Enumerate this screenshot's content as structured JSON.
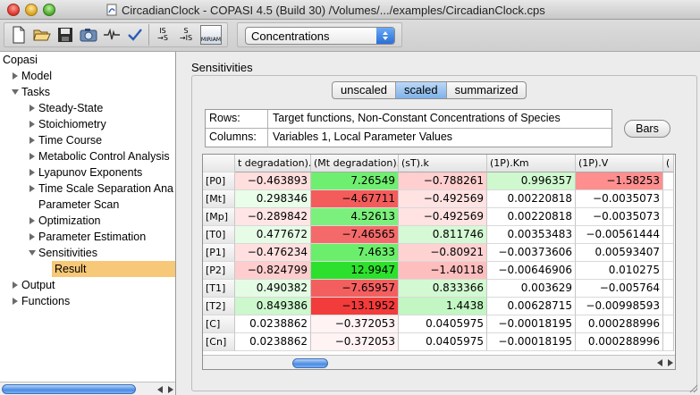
{
  "window": {
    "title": "CircadianClock - COPASI 4.5 (Build 30) /Volumes/.../examples/CircadianClock.cps"
  },
  "toolbar": {
    "buttons": [
      {
        "name": "new-document",
        "icon": "new-document-icon"
      },
      {
        "name": "open",
        "icon": "folder-open-icon"
      },
      {
        "name": "save",
        "icon": "floppy-disk-icon"
      },
      {
        "name": "capture",
        "icon": "camera-icon"
      },
      {
        "name": "signal",
        "icon": "waveform-icon"
      },
      {
        "name": "check",
        "icon": "checkmark-icon"
      },
      {
        "name": "is-to-s",
        "icon": "is-to-s-icon",
        "label_top": "IS",
        "label_bottom": "→S"
      },
      {
        "name": "s-to-is",
        "icon": "s-to-is-icon",
        "label_top": "S",
        "label_bottom": "→IS"
      },
      {
        "name": "miriam",
        "icon": "miriam-icon",
        "label": "MIRIAM"
      }
    ],
    "concentration_select": "Concentrations"
  },
  "tree": {
    "root": "Copasi",
    "items": [
      {
        "label": "Model",
        "expander": "collapsed"
      },
      {
        "label": "Tasks",
        "expander": "expanded"
      },
      {
        "label": "Steady-State",
        "expander": "collapsed"
      },
      {
        "label": "Stoichiometry",
        "expander": "collapsed"
      },
      {
        "label": "Time Course",
        "expander": "collapsed"
      },
      {
        "label": "Metabolic Control Analysis",
        "expander": "collapsed"
      },
      {
        "label": "Lyapunov Exponents",
        "expander": "collapsed"
      },
      {
        "label": "Time Scale Separation Ana",
        "expander": "collapsed"
      },
      {
        "label": "Parameter Scan",
        "expander": "none"
      },
      {
        "label": "Optimization",
        "expander": "collapsed"
      },
      {
        "label": "Parameter Estimation",
        "expander": "collapsed"
      },
      {
        "label": "Sensitivities",
        "expander": "expanded"
      },
      {
        "label": "Result",
        "expander": "none"
      },
      {
        "label": "Output",
        "expander": "collapsed"
      },
      {
        "label": "Functions",
        "expander": "collapsed"
      }
    ]
  },
  "main": {
    "section_title": "Sensitivities",
    "tabs": [
      {
        "label": "unscaled",
        "active": false
      },
      {
        "label": "scaled",
        "active": true
      },
      {
        "label": "summarized",
        "active": false
      }
    ],
    "info": {
      "rows_key": "Rows:",
      "rows_value": "Target functions, Non-Constant Concentrations of Species",
      "columns_key": "Columns:",
      "columns_value": "Variables 1, Local Parameter Values"
    },
    "bars_button": "Bars",
    "grid": {
      "columns": [
        "t degradation).l",
        "(Mt degradation).'",
        "(sT).k",
        "(1P).Km",
        "(1P).V",
        "("
      ],
      "rows": [
        {
          "label": "[P0]",
          "values": [
            "−0.463893",
            "7.26549",
            "−0.788261",
            "0.996357",
            "−1.58253"
          ]
        },
        {
          "label": "[Mt]",
          "values": [
            "0.298346",
            "−4.67711",
            "−0.492569",
            "0.00220818",
            "−0.0035073"
          ]
        },
        {
          "label": "[Mp]",
          "values": [
            "−0.289842",
            "4.52613",
            "−0.492569",
            "0.00220818",
            "−0.0035073"
          ]
        },
        {
          "label": "[T0]",
          "values": [
            "0.477672",
            "−7.46565",
            "0.811746",
            "0.00353483",
            "−0.00561444"
          ]
        },
        {
          "label": "[P1]",
          "values": [
            "−0.476234",
            "7.4633",
            "−0.80921",
            "−0.00373606",
            "0.00593407"
          ]
        },
        {
          "label": "[P2]",
          "values": [
            "−0.824799",
            "12.9947",
            "−1.40118",
            "−0.00646906",
            "0.010275"
          ]
        },
        {
          "label": "[T1]",
          "values": [
            "0.490382",
            "−7.65957",
            "0.833366",
            "0.003629",
            "−0.005764"
          ]
        },
        {
          "label": "[T2]",
          "values": [
            "0.849386",
            "−13.1952",
            "1.4438",
            "0.00628715",
            "−0.00998593"
          ]
        },
        {
          "label": "[C]",
          "values": [
            "0.0238862",
            "−0.372053",
            "0.0405975",
            "−0.00018195",
            "0.000288996"
          ]
        },
        {
          "label": "[Cn]",
          "values": [
            "0.0238862",
            "−0.372053",
            "0.0405975",
            "−0.00018195",
            "0.000288996"
          ]
        }
      ],
      "cell_colors": [
        [
          "#ffdede",
          "#6fef6f",
          "#ffcfcf",
          "#cff8cf",
          "#ff8f8f"
        ],
        [
          "#e9fde9",
          "#f45b5b",
          "#ffe2e2",
          "#ffffff",
          "#ffffff"
        ],
        [
          "#ffe5e5",
          "#7cf07c",
          "#ffe2e2",
          "#ffffff",
          "#ffffff"
        ],
        [
          "#e6fce6",
          "#f46a6a",
          "#d4f9d4",
          "#ffffff",
          "#ffffff"
        ],
        [
          "#ffdfdf",
          "#6bee6b",
          "#ffd2d2",
          "#ffffff",
          "#ffffff"
        ],
        [
          "#ffcdcd",
          "#2de02d",
          "#ffbebe",
          "#ffffff",
          "#ffffff"
        ],
        [
          "#e4fce4",
          "#f35f5f",
          "#d2f9d2",
          "#ffffff",
          "#ffffff"
        ],
        [
          "#cdf7cd",
          "#f23b3b",
          "#c2f6c2",
          "#ffffff",
          "#ffffff"
        ],
        [
          "#ffffff",
          "#fff3f3",
          "#ffffff",
          "#ffffff",
          "#ffffff"
        ],
        [
          "#ffffff",
          "#fff3f3",
          "#ffffff",
          "#ffffff",
          "#ffffff"
        ]
      ]
    }
  },
  "colors": {
    "selection": "#f6c877",
    "accent_blue": "#4a8be4"
  }
}
